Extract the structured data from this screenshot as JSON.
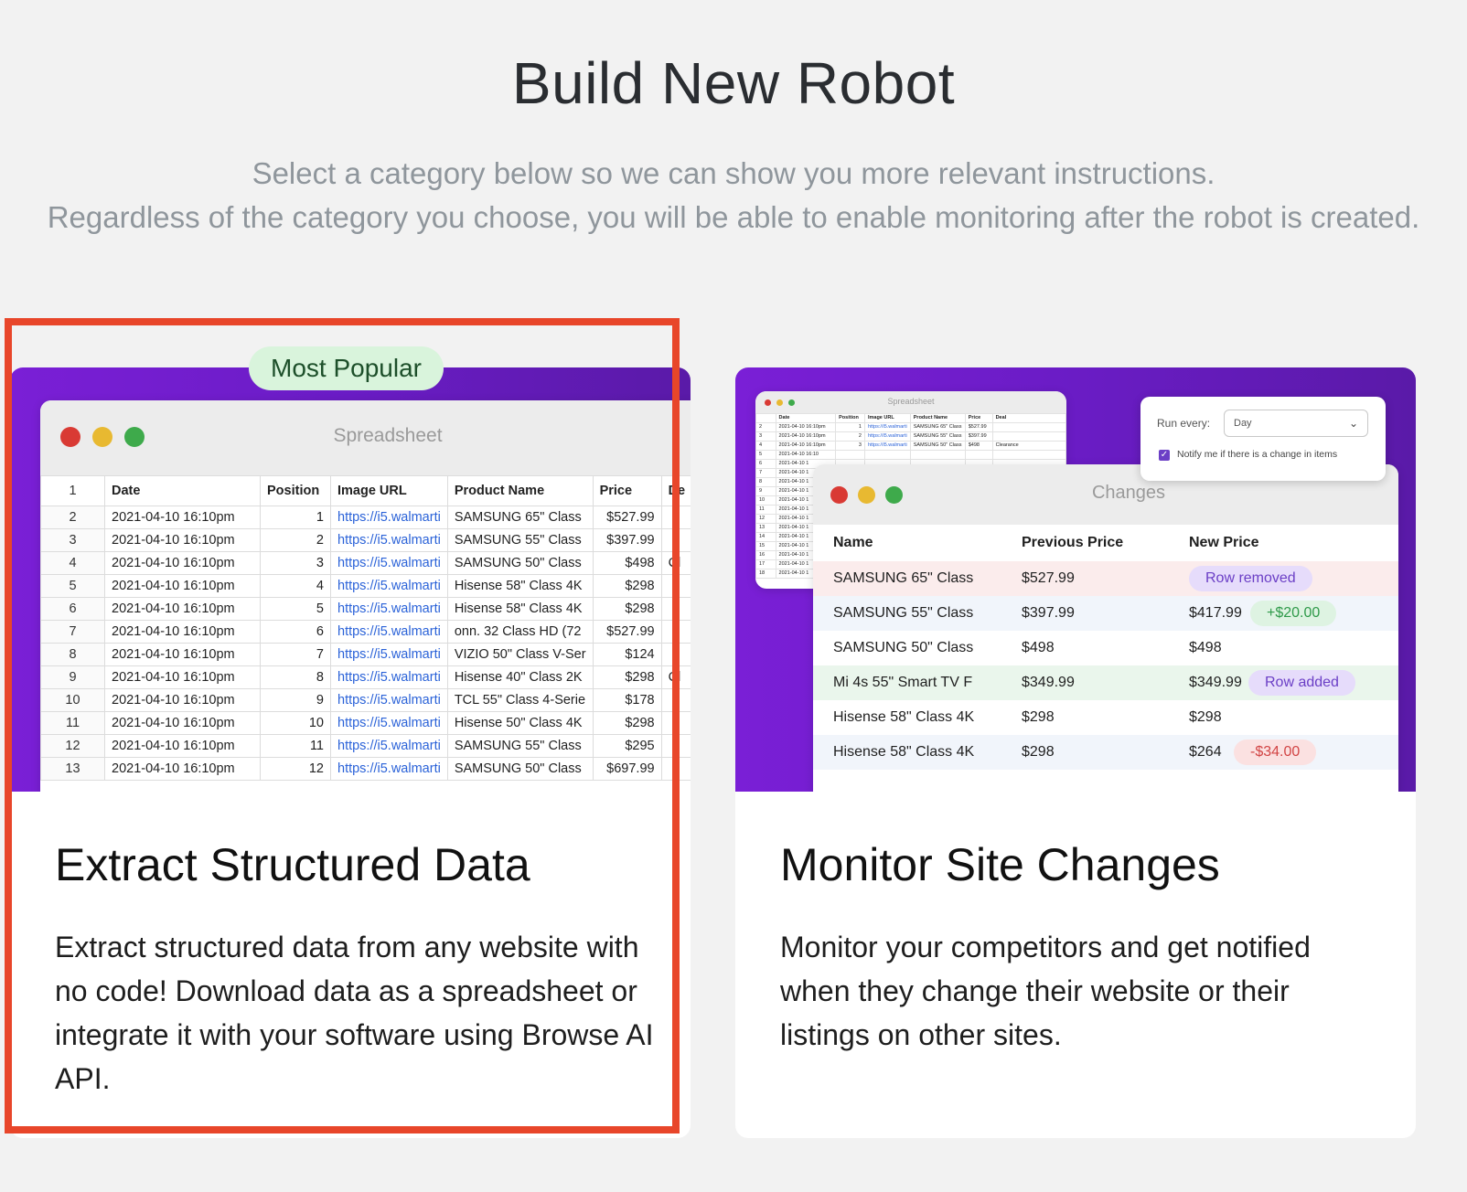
{
  "page": {
    "title": "Build New Robot",
    "subtitle_line1": "Select a category below so we can show you more relevant instructions.",
    "subtitle_line2": "Regardless of the category you choose, you will be able to enable monitoring after the robot is created."
  },
  "cards": {
    "extract": {
      "badge": "Most Popular",
      "heading": "Extract Structured Data",
      "description": "Extract structured data from any website with no code! Download data as a spreadsheet or integrate it with your software using Browse AI API.",
      "selected": true
    },
    "monitor": {
      "heading": "Monitor Site Changes",
      "description": "Monitor your competitors and get notified when they change their website or their listings on other sites."
    }
  },
  "spreadsheet": {
    "window_title": "Spreadsheet",
    "header_index": "1",
    "columns": [
      "Date",
      "Position",
      "Image URL",
      "Product Name",
      "Price",
      "De"
    ],
    "rows": [
      {
        "n": "2",
        "date": "2021-04-10 16:10pm",
        "pos": "1",
        "url": "https://i5.walmarti",
        "name": "SAMSUNG 65\" Class",
        "price": "$527.99",
        "deal": ""
      },
      {
        "n": "3",
        "date": "2021-04-10 16:10pm",
        "pos": "2",
        "url": "https://i5.walmarti",
        "name": "SAMSUNG 55\" Class",
        "price": "$397.99",
        "deal": ""
      },
      {
        "n": "4",
        "date": "2021-04-10 16:10pm",
        "pos": "3",
        "url": "https://i5.walmarti",
        "name": "SAMSUNG 50\" Class",
        "price": "$498",
        "deal": "Cl"
      },
      {
        "n": "5",
        "date": "2021-04-10 16:10pm",
        "pos": "4",
        "url": "https://i5.walmarti",
        "name": "Hisense 58\" Class 4K",
        "price": "$298",
        "deal": ""
      },
      {
        "n": "6",
        "date": "2021-04-10 16:10pm",
        "pos": "5",
        "url": "https://i5.walmarti",
        "name": "Hisense 58\" Class 4K",
        "price": "$298",
        "deal": ""
      },
      {
        "n": "7",
        "date": "2021-04-10 16:10pm",
        "pos": "6",
        "url": "https://i5.walmarti",
        "name": "onn. 32 Class HD (72",
        "price": "$527.99",
        "deal": ""
      },
      {
        "n": "8",
        "date": "2021-04-10 16:10pm",
        "pos": "7",
        "url": "https://i5.walmarti",
        "name": "VIZIO 50\" Class V-Ser",
        "price": "$124",
        "deal": ""
      },
      {
        "n": "9",
        "date": "2021-04-10 16:10pm",
        "pos": "8",
        "url": "https://i5.walmarti",
        "name": "Hisense 40\" Class 2K",
        "price": "$298",
        "deal": "Cl"
      },
      {
        "n": "10",
        "date": "2021-04-10 16:10pm",
        "pos": "9",
        "url": "https://i5.walmarti",
        "name": "TCL 55\" Class 4-Serie",
        "price": "$178",
        "deal": ""
      },
      {
        "n": "11",
        "date": "2021-04-10 16:10pm",
        "pos": "10",
        "url": "https://i5.walmarti",
        "name": "Hisense 50\" Class 4K",
        "price": "$298",
        "deal": ""
      },
      {
        "n": "12",
        "date": "2021-04-10 16:10pm",
        "pos": "11",
        "url": "https://i5.walmarti",
        "name": "SAMSUNG 55\" Class",
        "price": "$295",
        "deal": ""
      },
      {
        "n": "13",
        "date": "2021-04-10 16:10pm",
        "pos": "12",
        "url": "https://i5.walmarti",
        "name": "SAMSUNG 50\" Class",
        "price": "$697.99",
        "deal": ""
      }
    ]
  },
  "mini_spreadsheet": {
    "window_title": "Spreadsheet",
    "columns": [
      "",
      "Date",
      "Position",
      "Image URL",
      "Product Name",
      "Price",
      "Deal"
    ],
    "rows": [
      {
        "n": "2",
        "date": "2021-04-10 16:10pm",
        "pos": "1",
        "url": "https://i5.walmarti",
        "name": "SAMSUNG 65\" Class",
        "price": "$527.99",
        "deal": ""
      },
      {
        "n": "3",
        "date": "2021-04-10 16:10pm",
        "pos": "2",
        "url": "https://i5.walmarti",
        "name": "SAMSUNG 55\" Class",
        "price": "$397.99",
        "deal": ""
      },
      {
        "n": "4",
        "date": "2021-04-10 16:10pm",
        "pos": "3",
        "url": "https://i5.walmarti",
        "name": "SAMSUNG 50\" Class",
        "price": "$498",
        "deal": "Clearance"
      },
      {
        "n": "5",
        "date": "2021-04-10 16:10",
        "pos": "",
        "url": "",
        "name": "",
        "price": "",
        "deal": ""
      },
      {
        "n": "6",
        "date": "2021-04-10 1",
        "pos": "",
        "url": "",
        "name": "",
        "price": "",
        "deal": ""
      },
      {
        "n": "7",
        "date": "2021-04-10 1",
        "pos": "",
        "url": "",
        "name": "",
        "price": "",
        "deal": ""
      },
      {
        "n": "8",
        "date": "2021-04-10 1",
        "pos": "",
        "url": "",
        "name": "",
        "price": "",
        "deal": ""
      },
      {
        "n": "9",
        "date": "2021-04-10 1",
        "pos": "",
        "url": "",
        "name": "",
        "price": "",
        "deal": ""
      },
      {
        "n": "10",
        "date": "2021-04-10 1",
        "pos": "",
        "url": "",
        "name": "",
        "price": "",
        "deal": ""
      },
      {
        "n": "11",
        "date": "2021-04-10 1",
        "pos": "",
        "url": "",
        "name": "",
        "price": "",
        "deal": ""
      },
      {
        "n": "12",
        "date": "2021-04-10 1",
        "pos": "",
        "url": "",
        "name": "",
        "price": "",
        "deal": ""
      },
      {
        "n": "13",
        "date": "2021-04-10 1",
        "pos": "",
        "url": "",
        "name": "",
        "price": "",
        "deal": ""
      },
      {
        "n": "14",
        "date": "2021-04-10 1",
        "pos": "",
        "url": "",
        "name": "",
        "price": "",
        "deal": ""
      },
      {
        "n": "15",
        "date": "2021-04-10 1",
        "pos": "",
        "url": "",
        "name": "",
        "price": "",
        "deal": ""
      },
      {
        "n": "16",
        "date": "2021-04-10 1",
        "pos": "",
        "url": "",
        "name": "",
        "price": "",
        "deal": ""
      },
      {
        "n": "17",
        "date": "2021-04-10 1",
        "pos": "",
        "url": "",
        "name": "",
        "price": "",
        "deal": ""
      },
      {
        "n": "18",
        "date": "2021-04-10 1",
        "pos": "",
        "url": "",
        "name": "",
        "price": "",
        "deal": ""
      }
    ]
  },
  "changes": {
    "window_title": "Changes",
    "columns": [
      "Name",
      "Previous Price",
      "New Price"
    ],
    "rows": [
      {
        "name": "SAMSUNG 65\" Class",
        "prev": "$527.99",
        "new": "",
        "badge": "Row removed",
        "status": "removed"
      },
      {
        "name": "SAMSUNG 55\" Class",
        "prev": "$397.99",
        "new": "$417.99",
        "badge": "+$20.00",
        "status": "changed"
      },
      {
        "name": "SAMSUNG 50\" Class",
        "prev": "$498",
        "new": "$498",
        "badge": "",
        "status": "same"
      },
      {
        "name": "Mi 4s 55\" Smart TV F",
        "prev": "$349.99",
        "new": "$349.99",
        "badge": "Row added",
        "status": "added"
      },
      {
        "name": "Hisense 58\" Class 4K",
        "prev": "$298",
        "new": "$298",
        "badge": "",
        "status": "same"
      },
      {
        "name": "Hisense 58\" Class 4K",
        "prev": "$298",
        "new": "$264",
        "badge": "-$34.00",
        "status": "decrease"
      }
    ]
  },
  "monitor_popup": {
    "label": "Run every:",
    "value": "Day",
    "checkbox_checked": true,
    "checkbox_label": "Notify me if there is a change in items"
  },
  "colors": {
    "accent": "#6a1cc5",
    "selection_border": "#e8462a",
    "badge_bg": "#d9f4dc",
    "link": "#2a62d8"
  }
}
